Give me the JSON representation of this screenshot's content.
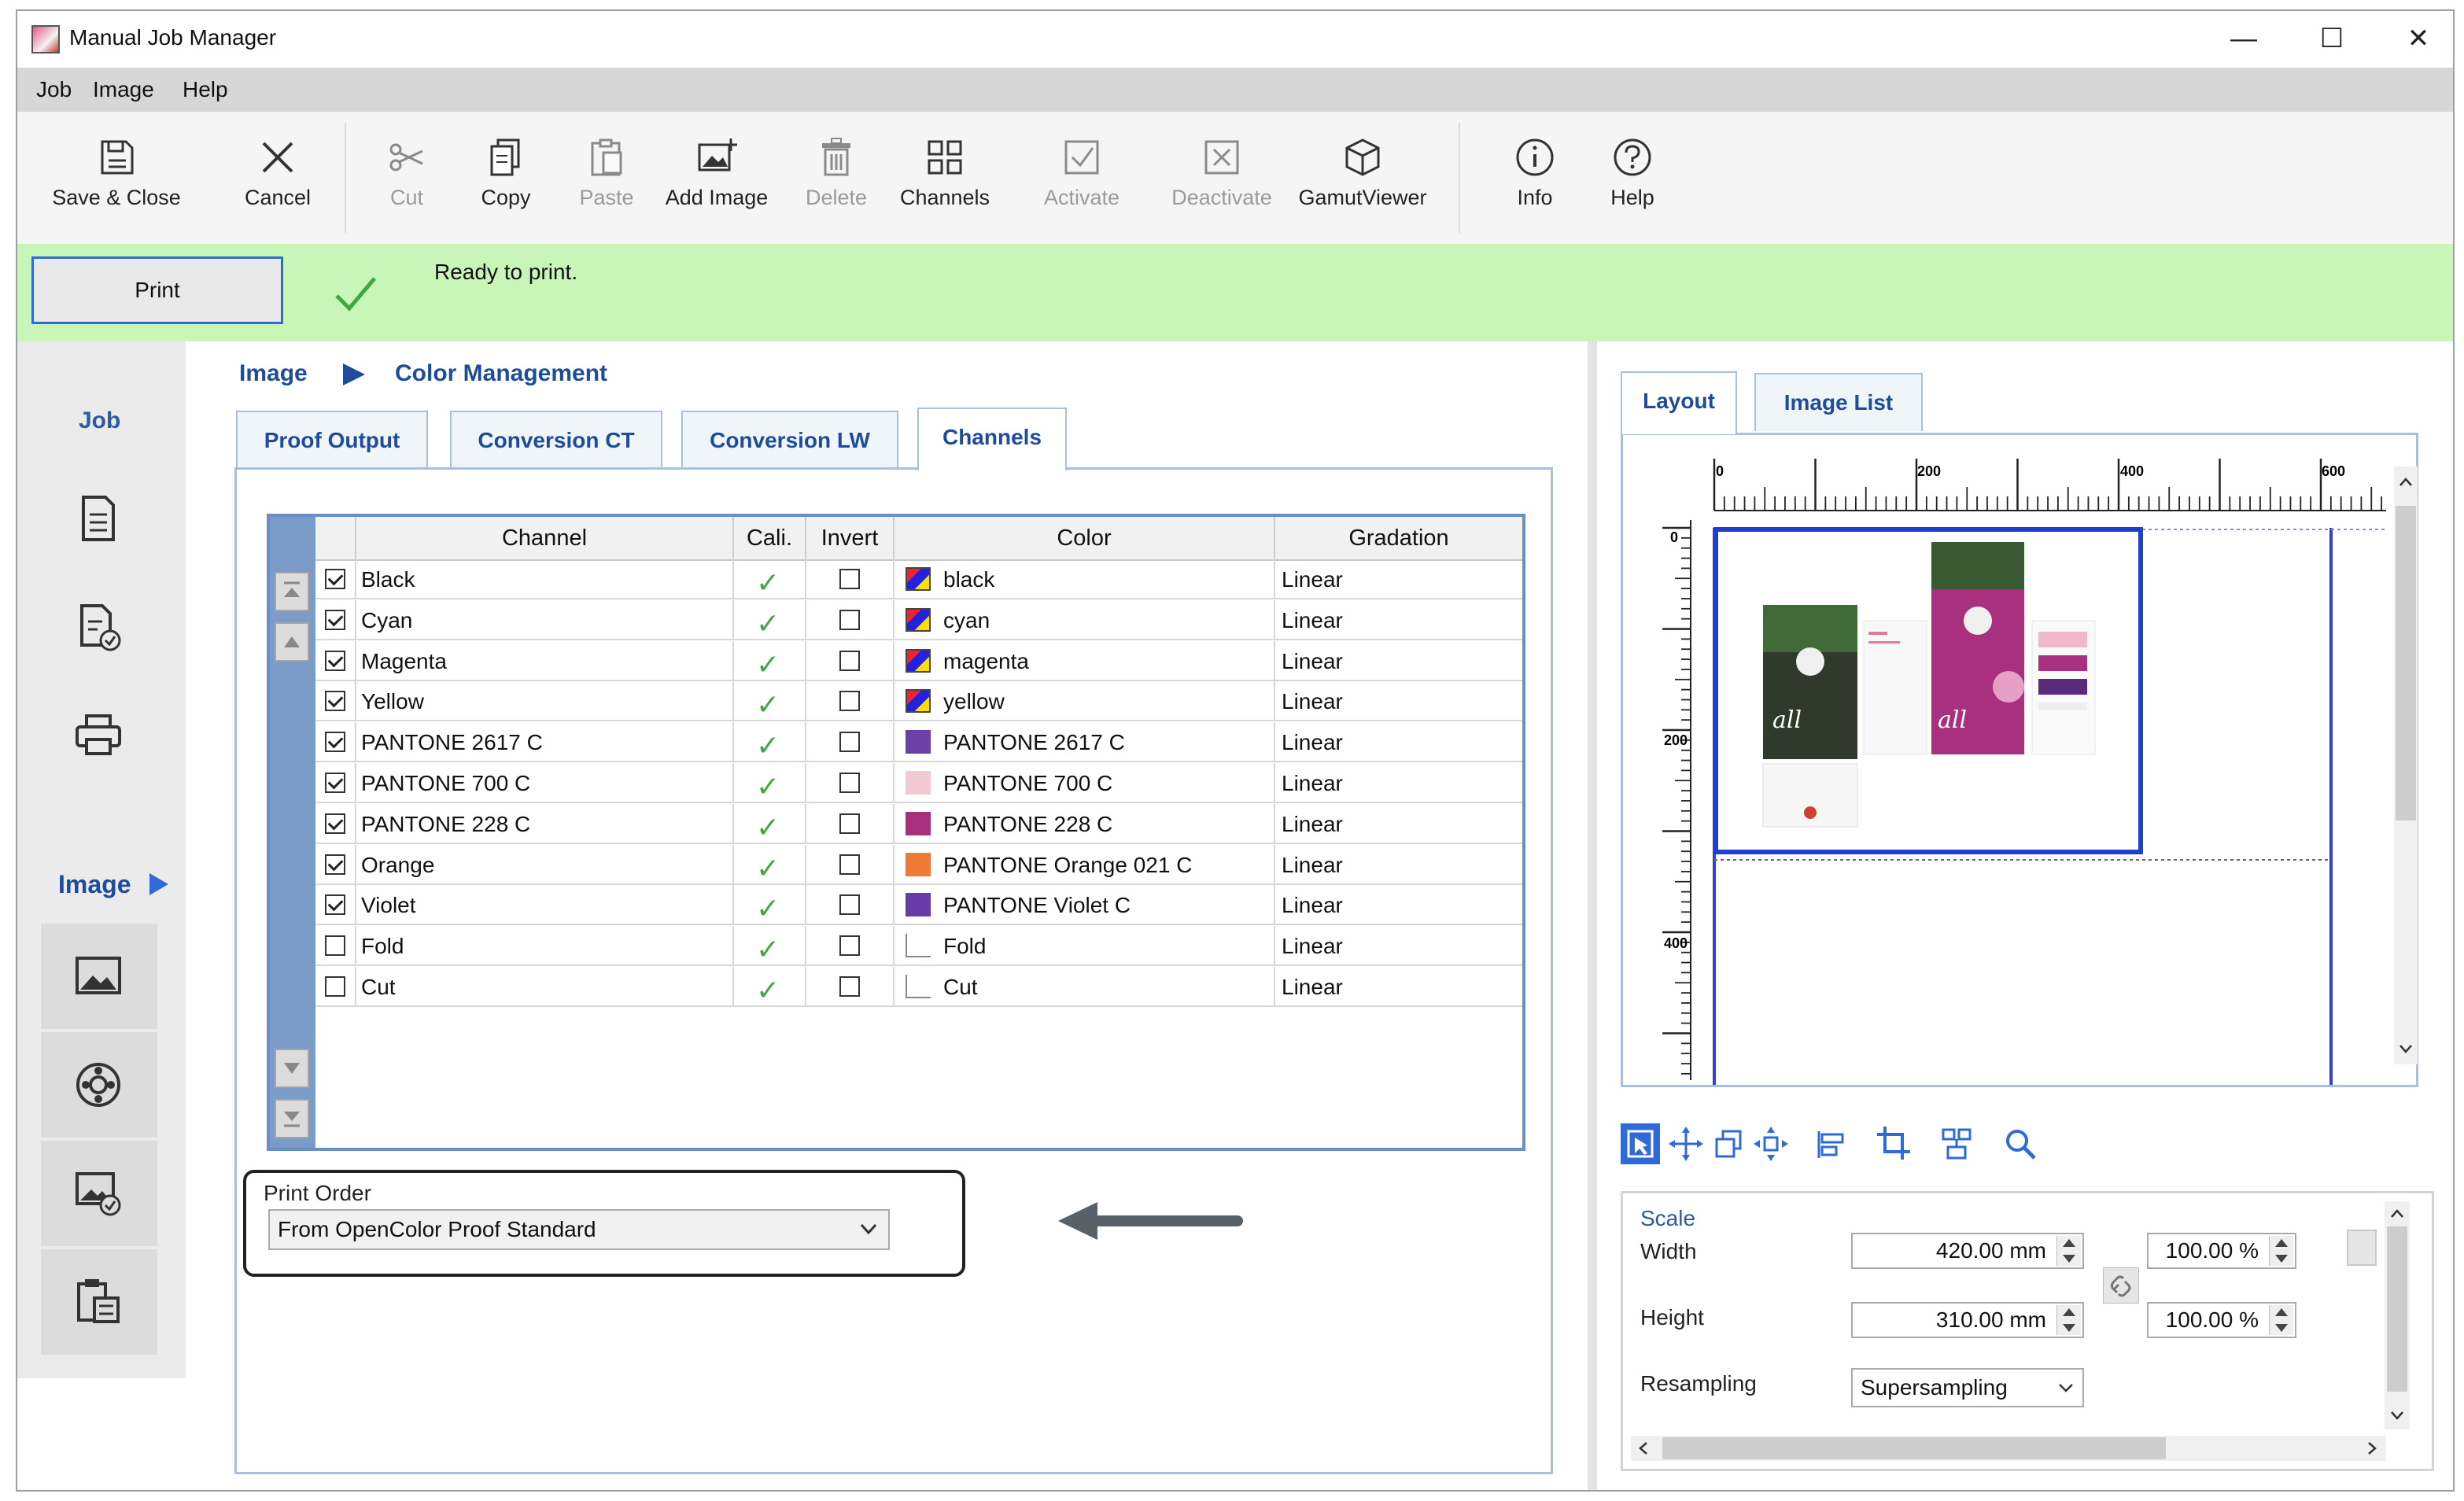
{
  "window": {
    "title": "Manual Job Manager",
    "controls": [
      "—",
      "☐",
      "✕"
    ]
  },
  "menu": [
    "Job",
    "Image",
    "Help"
  ],
  "toolbar": {
    "save_close": "Save & Close",
    "cancel": "Cancel",
    "cut": "Cut",
    "copy": "Copy",
    "paste": "Paste",
    "add_image": "Add Image",
    "delete": "Delete",
    "channels": "Channels",
    "activate": "Activate",
    "deactivate": "Deactivate",
    "gamut_viewer": "GamutViewer",
    "info": "Info",
    "help": "Help"
  },
  "status": {
    "print_label": "Print",
    "message": "Ready to print.",
    "bar_color": "#c8f5b8"
  },
  "leftnav": {
    "job": "Job",
    "image": "Image"
  },
  "breadcrumb": {
    "level1": "Image",
    "level2": "Color Management"
  },
  "tabs": [
    "Proof Output",
    "Conversion CT",
    "Conversion LW",
    "Channels"
  ],
  "active_tab": "Channels",
  "table": {
    "headers": [
      "Channel",
      "Cali.",
      "Invert",
      "Color",
      "Gradation"
    ],
    "rows": [
      {
        "checked": true,
        "channel": "Black",
        "cali": true,
        "invert": false,
        "color": "black",
        "swatch": "multi",
        "gradation": "Linear"
      },
      {
        "checked": true,
        "channel": "Cyan",
        "cali": true,
        "invert": false,
        "color": "cyan",
        "swatch": "multi",
        "gradation": "Linear"
      },
      {
        "checked": true,
        "channel": "Magenta",
        "cali": true,
        "invert": false,
        "color": "magenta",
        "swatch": "multi",
        "gradation": "Linear"
      },
      {
        "checked": true,
        "channel": "Yellow",
        "cali": true,
        "invert": false,
        "color": "yellow",
        "swatch": "multi",
        "gradation": "Linear"
      },
      {
        "checked": true,
        "channel": "PANTONE 2617 C",
        "cali": true,
        "invert": false,
        "color": "PANTONE 2617 C",
        "swatch": "#6e3fa6",
        "gradation": "Linear"
      },
      {
        "checked": true,
        "channel": "PANTONE 700 C",
        "cali": true,
        "invert": false,
        "color": "PANTONE 700 C",
        "swatch": "#f2c9d2",
        "gradation": "Linear"
      },
      {
        "checked": true,
        "channel": "PANTONE 228 C",
        "cali": true,
        "invert": false,
        "color": "PANTONE 228 C",
        "swatch": "#a8307e",
        "gradation": "Linear"
      },
      {
        "checked": true,
        "channel": "Orange",
        "cali": true,
        "invert": false,
        "color": "PANTONE Orange 021 C",
        "swatch": "#ee7a36",
        "gradation": "Linear"
      },
      {
        "checked": true,
        "channel": "Violet",
        "cali": true,
        "invert": false,
        "color": "PANTONE Violet C",
        "swatch": "#6a3aa8",
        "gradation": "Linear"
      },
      {
        "checked": false,
        "channel": "Fold",
        "cali": true,
        "invert": false,
        "color": "Fold",
        "swatch": "blank",
        "gradation": "Linear"
      },
      {
        "checked": false,
        "channel": "Cut",
        "cali": true,
        "invert": false,
        "color": "Cut",
        "swatch": "blank",
        "gradation": "Linear"
      }
    ]
  },
  "print_order": {
    "label": "Print Order",
    "value": "From OpenColor Proof Standard"
  },
  "right_tabs": [
    "Layout",
    "Image List"
  ],
  "ruler": {
    "top_labels": [
      "0",
      "200",
      "400",
      "600"
    ],
    "left_labels": [
      "0",
      "200",
      "400"
    ]
  },
  "scale": {
    "title": "Scale",
    "width_label": "Width",
    "width_value": "420.00 mm",
    "width_pct": "100.00 %",
    "height_label": "Height",
    "height_value": "310.00 mm",
    "height_pct": "100.00 %",
    "resampling_label": "Resampling",
    "resampling_value": "Supersampling"
  }
}
